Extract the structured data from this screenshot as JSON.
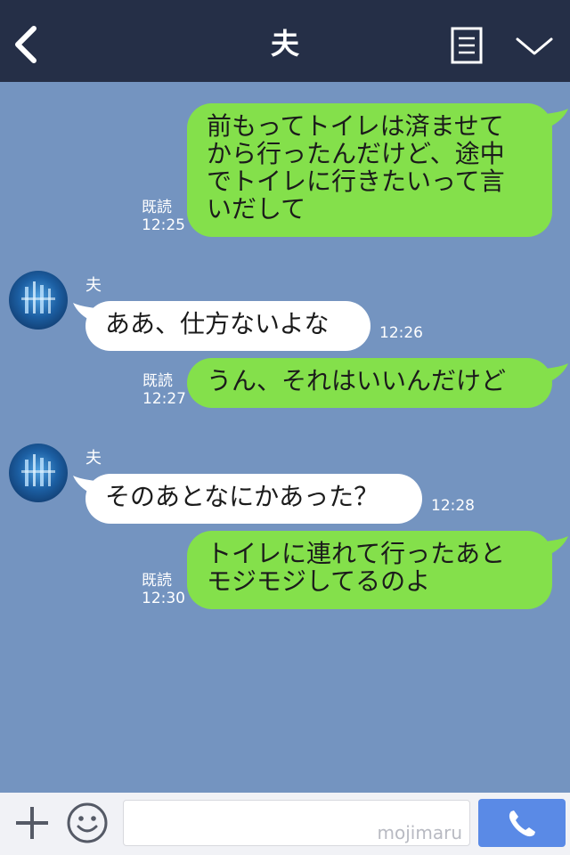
{
  "header": {
    "title": "夫"
  },
  "colors": {
    "header_bg": "#252f47",
    "chat_bg": "#7494c0",
    "outgoing_bubble": "#84e04b",
    "incoming_bubble": "#ffffff",
    "send_button": "#5a8ae6"
  },
  "icons": {
    "back": "chevron-left-icon",
    "notes": "notes-icon",
    "menu": "chevron-down-icon",
    "add": "plus-icon",
    "emoji": "smiley-icon",
    "call": "phone-icon"
  },
  "messages": [
    {
      "direction": "out",
      "text": "前もってトイレは済ませて\nから行ったんだけど、途中\nでトイレに行きたいって言\nいだして",
      "read": "既読",
      "time": "12:25"
    },
    {
      "direction": "in",
      "sender": "夫",
      "text": "ああ、仕方ないよな",
      "time": "12:26"
    },
    {
      "direction": "out",
      "text": "うん、それはいいんだけど",
      "read": "既読",
      "time": "12:27"
    },
    {
      "direction": "in",
      "sender": "夫",
      "text": "そのあとなにかあった？",
      "time": "12:28"
    },
    {
      "direction": "out",
      "text": "トイレに連れて行ったあと\nモジモジしてるのよ",
      "read": "既読",
      "time": "12:30"
    }
  ],
  "composer": {
    "watermark": "mojimaru"
  }
}
